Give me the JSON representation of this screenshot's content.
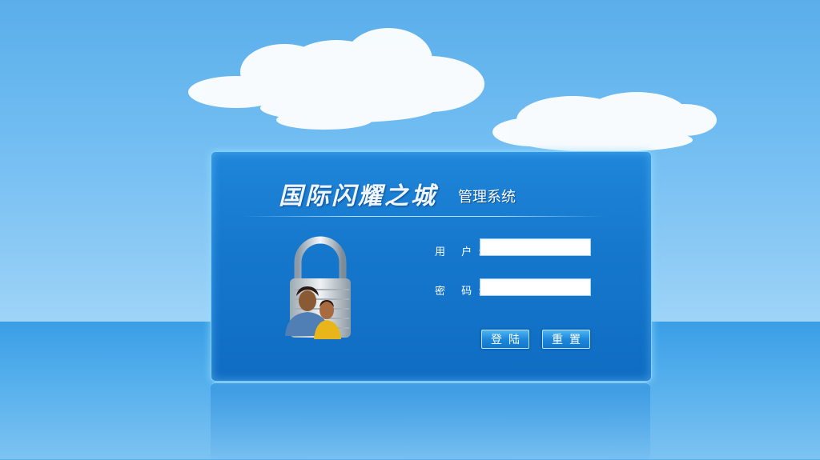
{
  "header": {
    "logo_text": "国际闪耀之城",
    "subtitle": "管理系统"
  },
  "login": {
    "username_label": "用 户:",
    "password_label": "密 码:",
    "username_value": "",
    "password_value": "",
    "login_button": "登陆",
    "reset_button": "重置"
  },
  "icons": {
    "lock": "lock-users-icon"
  },
  "colors": {
    "panel": "#1677cc",
    "sky": "#71bdf2",
    "button": "#1f88d9"
  }
}
